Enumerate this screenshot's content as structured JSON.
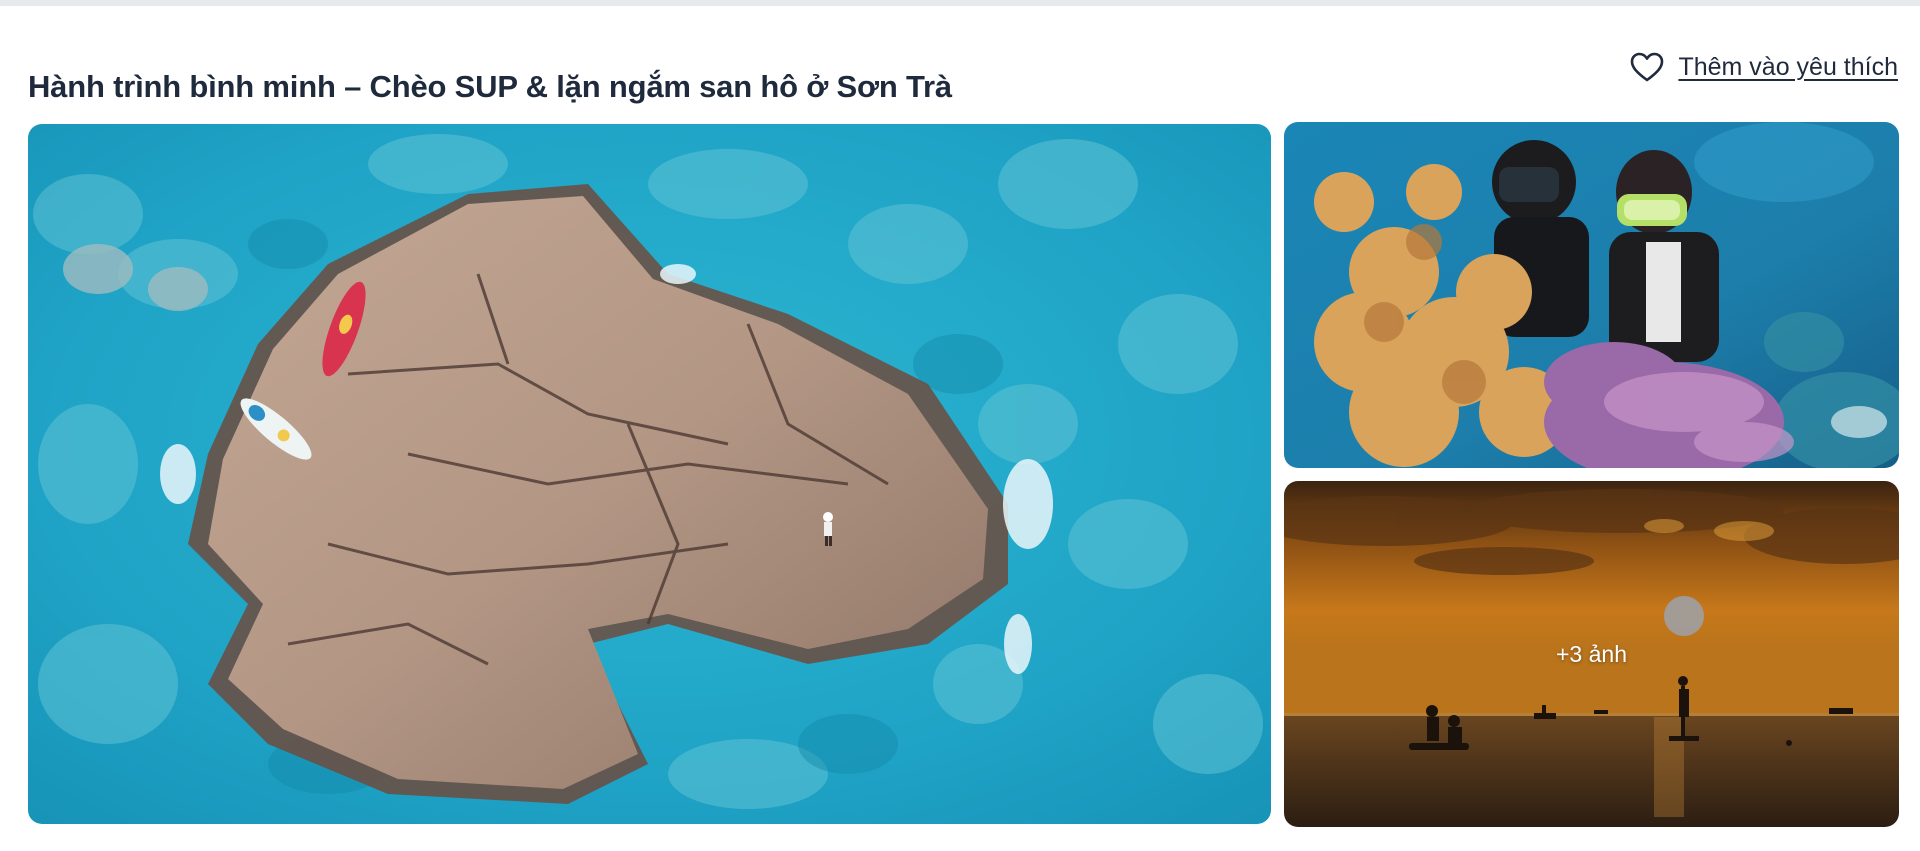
{
  "header": {
    "title": "Hành trình bình minh – Chèo SUP & lặn ngắm san hô ở Sơn Trà",
    "favorite_label": "Thêm vào yêu thích",
    "favorite_icon": "heart-outline-icon"
  },
  "gallery": {
    "main_photo": {
      "subject": "aerial-rock-reef-sea"
    },
    "side_top_photo": {
      "subject": "divers-coral-reef"
    },
    "side_bottom_photo": {
      "subject": "sunset-sup-silhouettes",
      "overlay_label": "+3 ảnh"
    }
  },
  "colors": {
    "text_primary": "#1f2a3d",
    "sea": "#27a9c9",
    "rock": "#b69a88",
    "sunset": "#c7781a"
  }
}
